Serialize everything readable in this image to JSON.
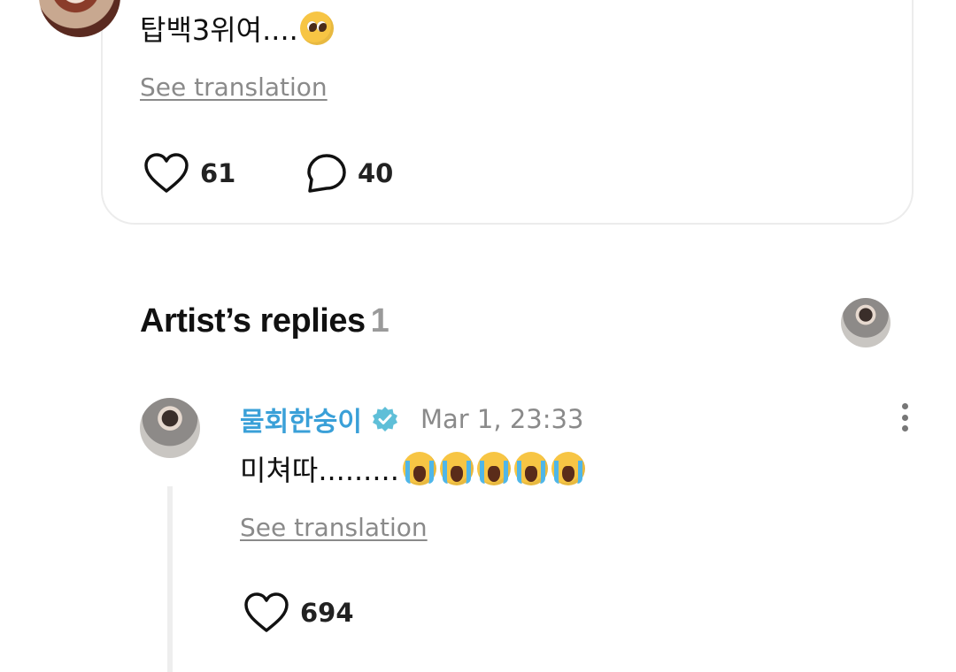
{
  "post": {
    "text": "탑백3위여....",
    "emoji": "pleading-face-emoji",
    "see_translation": "See translation",
    "likes": "61",
    "comments": "40"
  },
  "artist_replies": {
    "title": "Artist’s replies",
    "count": "1"
  },
  "reply": {
    "author": "물회한숭이",
    "verified": true,
    "timestamp": "Mar 1, 23:33",
    "text": "미쳐따.........",
    "emojis": [
      "loudly-crying-face-emoji",
      "loudly-crying-face-emoji",
      "loudly-crying-face-emoji",
      "loudly-crying-face-emoji",
      "loudly-crying-face-emoji"
    ],
    "see_translation": "See translation",
    "likes": "694"
  },
  "colors": {
    "author": "#3aa0d8",
    "muted": "#8a8a8a",
    "count": "#9a9a9a",
    "card_border": "#ececec"
  }
}
